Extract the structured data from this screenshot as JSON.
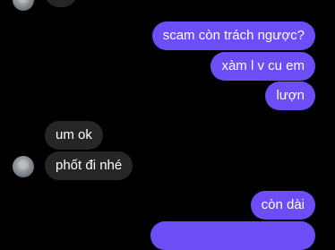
{
  "thread": {
    "messages": [
      {
        "from": "them",
        "text": ""
      },
      {
        "from": "me",
        "text": "scam còn trách ngược?"
      },
      {
        "from": "me",
        "text": "xàm l v cu em"
      },
      {
        "from": "me",
        "text": "lượn"
      },
      {
        "from": "them",
        "text": "um ok"
      },
      {
        "from": "them",
        "text": "phốt đi nhé"
      },
      {
        "from": "me",
        "text": "còn dài"
      },
      {
        "from": "me",
        "text": ""
      }
    ]
  },
  "colors": {
    "background": "#000000",
    "sent_bubble": "#6c4df6",
    "received_bubble": "#262626",
    "text": "#ffffff"
  }
}
